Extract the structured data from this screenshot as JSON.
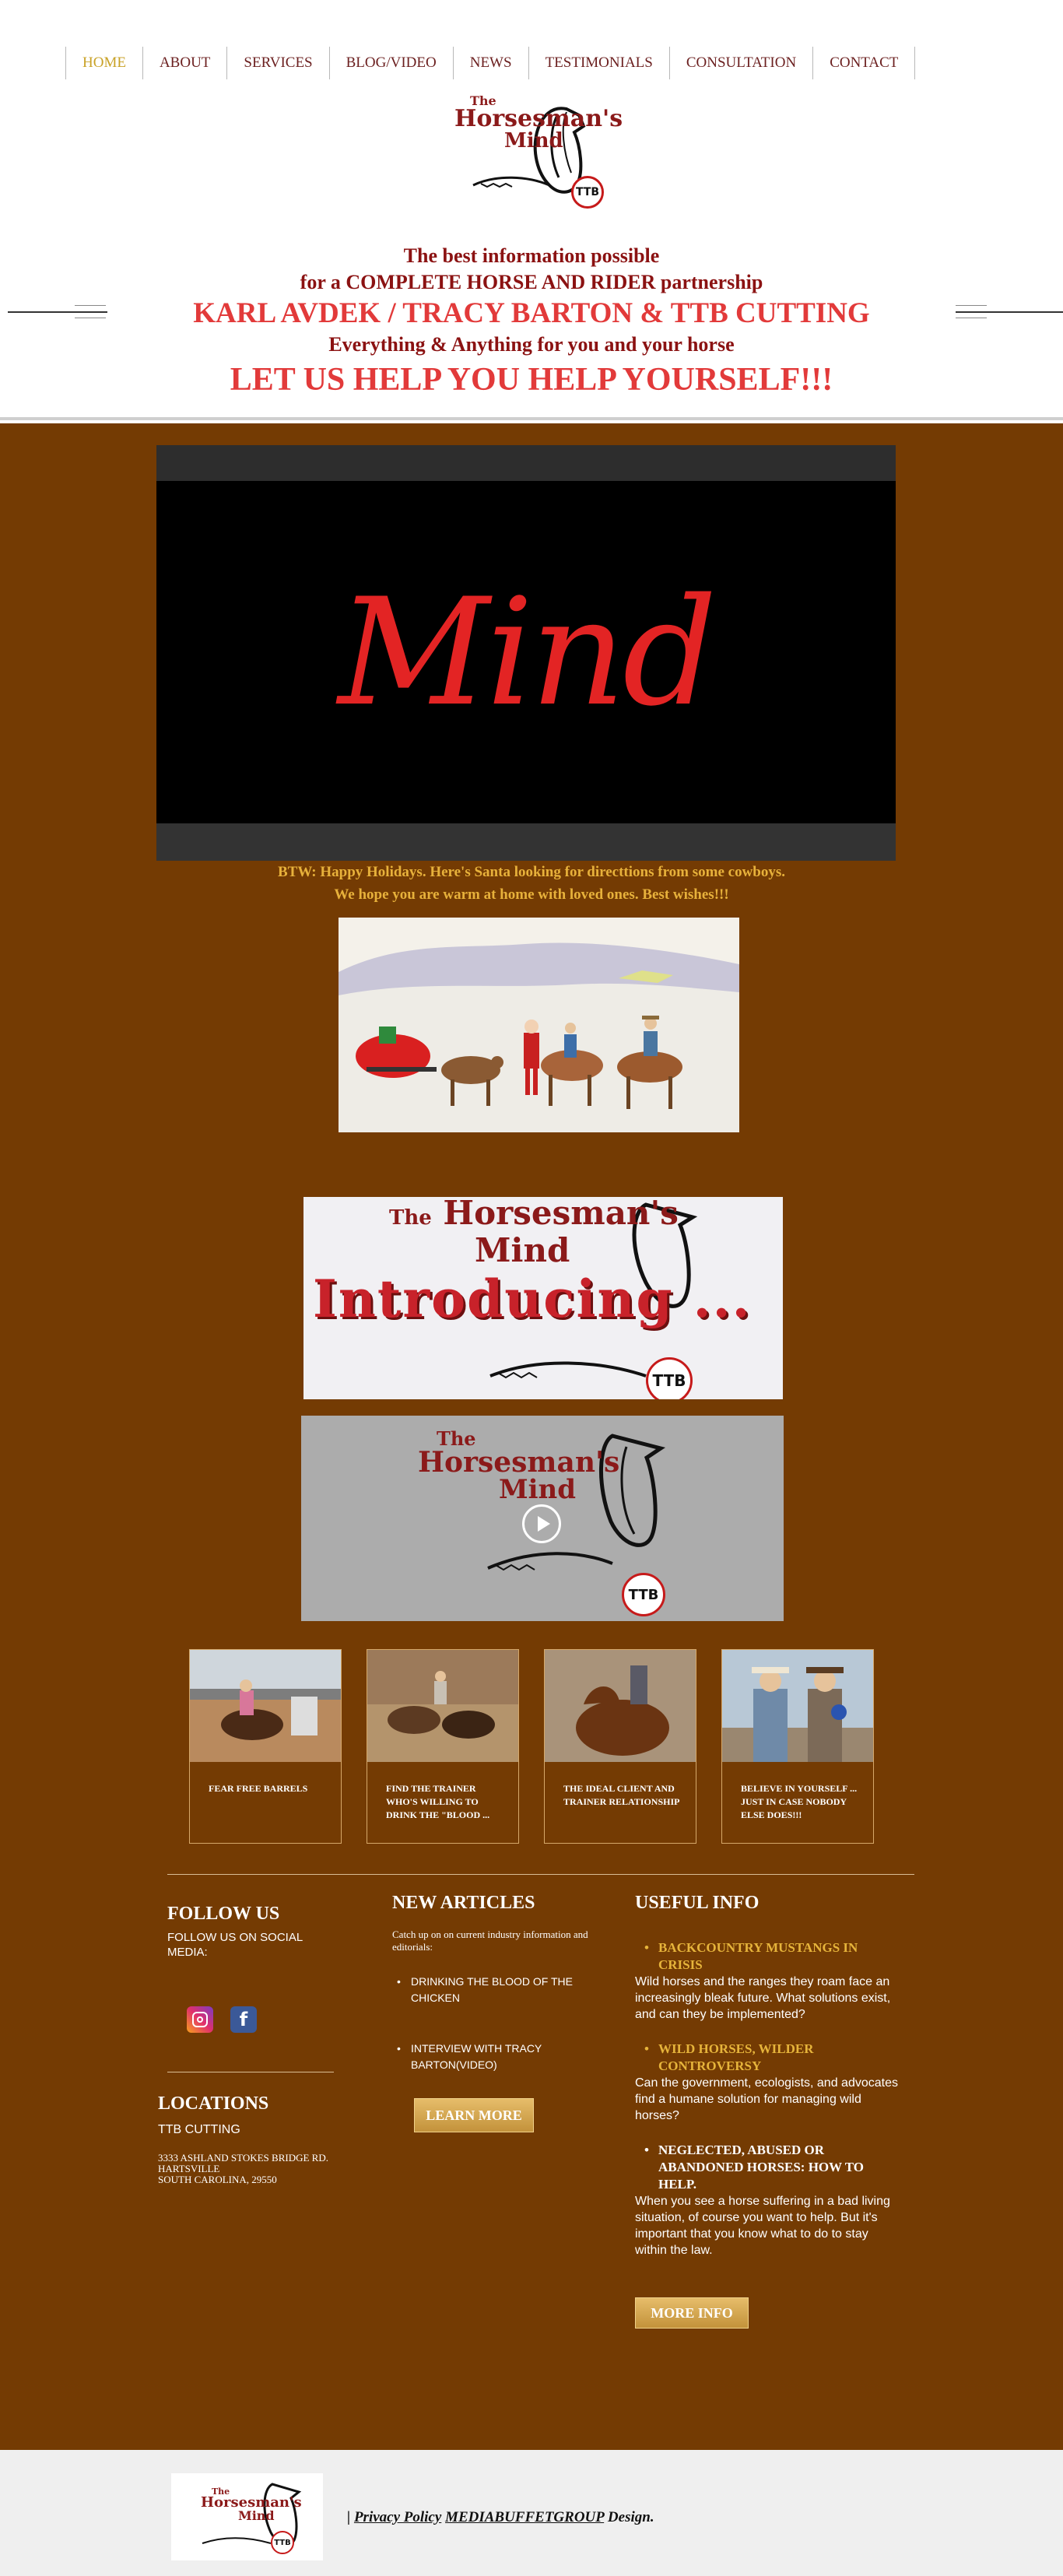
{
  "nav": {
    "items": [
      {
        "label": "HOME"
      },
      {
        "label": "ABOUT"
      },
      {
        "label": "SERVICES"
      },
      {
        "label": "BLOG/VIDEO"
      },
      {
        "label": "NEWS"
      },
      {
        "label": "TESTIMONIALS"
      },
      {
        "label": "CONSULTATION"
      },
      {
        "label": "CONTACT"
      }
    ],
    "active": "HOME"
  },
  "logo": {
    "line1": "The",
    "line2": "Horsesman's",
    "line3": "Mind",
    "badge": "TTB"
  },
  "hero": {
    "line1": "The best information possible",
    "line2": "for a COMPLETE HORSE AND RIDER partnership",
    "line3": "KARL AVDEK / TRACY BARTON & TTB CUTTING",
    "line4": "Everything & Anything for you and your horse",
    "line5": "LET US HELP YOU HELP YOURSELF!!!"
  },
  "video": {
    "title": "Mind"
  },
  "btw": {
    "line1": "BTW:  Happy Holidays. Here's Santa looking for directtions from some cowboys.",
    "line2": "We hope you are warm at home with loved ones.  Best wishes!!!"
  },
  "intro_banner": {
    "title_line1": "The",
    "title_line2": "Horsesman's",
    "title_line3": "Mind",
    "headline": "Introducing ...",
    "badge": "TTB"
  },
  "video2": {
    "title_line1": "The",
    "title_line2": "Horsesman's",
    "title_line3": "Mind",
    "badge": "TTB"
  },
  "cards": [
    {
      "caption": "Fear Free Barrels"
    },
    {
      "caption": "Find the trainer who's willing to drink the \"blood ..."
    },
    {
      "caption": "The ideal client and trainer relationship"
    },
    {
      "caption": "Believe in yourself ... just in case nobody else does!!!"
    }
  ],
  "follow": {
    "heading": "FOLLOW US",
    "sub": "FOLLOW US ON SOCIAL MEDIA:",
    "instagram_icon": "instagram-icon",
    "facebook_icon": "facebook-icon",
    "facebook_glyph": "f"
  },
  "locations": {
    "heading": "LOCATIONS",
    "sub": "TTB CUTTING",
    "addr1": "3333 ASHLAND STOKES BRIDGE RD.",
    "addr2": "HARTSVILLE",
    "addr3": "SOUTH CAROLINA, 29550"
  },
  "articles": {
    "heading": "NEW ARTICLES",
    "desc": "Catch up on on current industry information and editorials:",
    "link1": "DRINKING THE BLOOD OF THE CHICKEN",
    "link2": "INTERVIEW WITH TRACY BARTON(VIDEO)",
    "button": "LEARN MORE"
  },
  "useful": {
    "heading": "USEFUL INFO",
    "items": [
      {
        "title": "BACKCOUNTRY MUSTANGS IN CRISIS",
        "desc": " Wild horses and the ranges they roam face an increasingly bleak future. What solutions exist, and can they be implemented?"
      },
      {
        "title": "WILD HORSES, WILDER CONTROVERSY",
        "desc": " Can the government, ecologists, and advocates find a humane solution for managing wild horses?"
      },
      {
        "title": "NEGLECTED, ABUSED OR ABANDONED HORSES: HOW TO HELP.",
        "desc": "When you see a horse suffering in a bad living situation, of course you want to help. But it's important that you know what to do to stay within the law."
      }
    ],
    "button": "MORE INFO"
  },
  "footer": {
    "sep": "| ",
    "privacy": "Privacy Policy",
    "company": "MEDIABUFFETGROUP",
    "design": " Design."
  },
  "colors": {
    "brown_bg": "#743b03",
    "accent_gold": "#e6b43b",
    "brand_red": "#e23a3a",
    "dark_red": "#8b1212"
  }
}
